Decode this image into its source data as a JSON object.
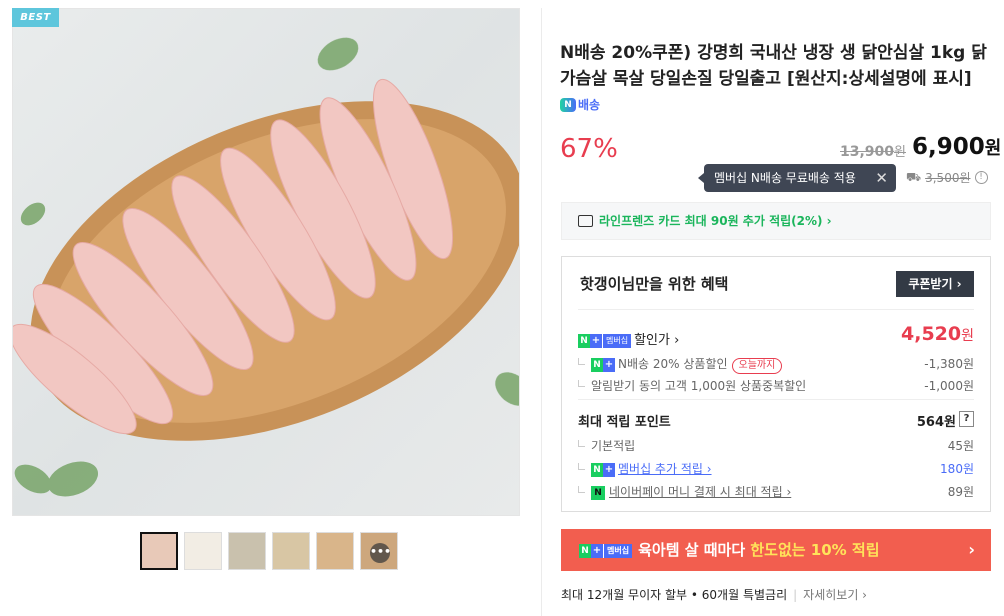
{
  "product_image": {
    "badge": "BEST"
  },
  "thumbnails": {
    "more_label": "•••"
  },
  "product": {
    "title": "N배송 20%쿠폰) 강명희 국내산 냉장 생 닭안심살 1kg 닭가슴살 목살 당일손질 당일출고 [원산지:상세설명에 표시]",
    "delivery_badge": "배송",
    "delivery_badge_letter": "N",
    "discount": "67%",
    "original_price": "13,900",
    "original_price_unit": "원",
    "price": "6,900",
    "price_unit": "원",
    "tooltip": "멤버십 N배송 무료배송 적용",
    "shipping_fee": "3,500원"
  },
  "card_banner": {
    "text": "라인프렌즈 카드 최대 90원 추가 적립(2%) ›"
  },
  "benefits": {
    "title": "핫갱이님만을 위한 혜택",
    "coupon_button": "쿠폰받기 ›",
    "membership_price_label": "할인가 ›",
    "membership_price": "4,520",
    "membership_price_unit": "원",
    "discount_rows": [
      {
        "label": "N배송 20% 상품할인",
        "pill": "오늘까지",
        "value": "-1,380원"
      },
      {
        "label": "알림받기 동의 고객 1,000원 상품중복할인",
        "value": "-1,000원"
      }
    ],
    "points_title": "최대 적립 포인트",
    "points_total": "564원",
    "points_help": "?",
    "point_rows": [
      {
        "label": "기본적립",
        "value": "45원"
      },
      {
        "label": "멤버십 추가 적립 ›",
        "value": "180원"
      },
      {
        "label": "네이버페이 머니 결제 시 최대 적립 ›",
        "value": "89원"
      }
    ],
    "membership_badge": {
      "n": "N",
      "plus": "+",
      "text": "멤버십"
    },
    "npay_badge": "N"
  },
  "promo": {
    "text_a": "육아템 살 때마다 ",
    "text_b": "한도없는 10% 적립",
    "arrow": "›"
  },
  "installment": {
    "text": "최대 12개월 무이자 할부 • 60개월 특별금리",
    "link": "자세히보기 ›"
  },
  "colors": {
    "accent_red": "#e83d4f",
    "naver_green": "#19ce60",
    "membership_blue": "#4a6cf7",
    "promo_bg": "#f25e4f"
  }
}
